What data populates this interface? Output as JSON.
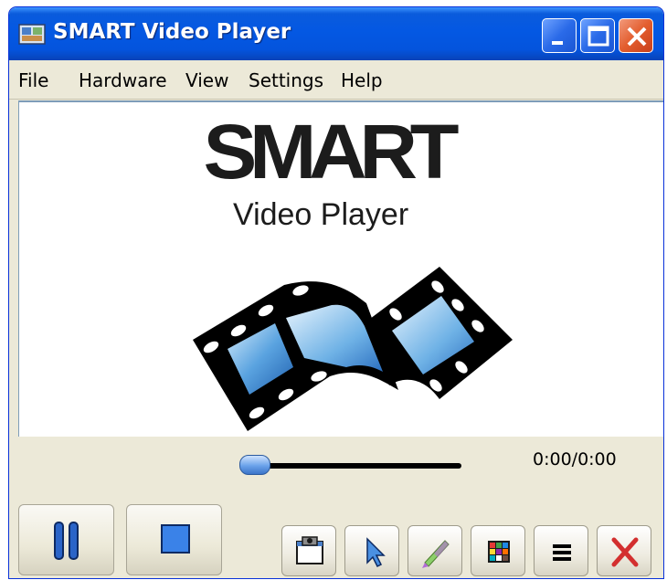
{
  "window": {
    "title": "SMART Video Player"
  },
  "menu": {
    "items": [
      "File",
      "Hardware",
      "View",
      "Settings",
      "Help"
    ]
  },
  "video": {
    "logo_text": "SMART",
    "logo_subtitle": "Video Player"
  },
  "playback": {
    "time_display": "0:00/0:00",
    "progress_fraction": 0
  },
  "colors": {
    "titlebar_blue": "#0458e3",
    "close_red": "#e35d2e",
    "film_blue": "#3b8ed8"
  },
  "icons": {
    "pause": "pause-icon",
    "stop": "stop-icon",
    "capture": "capture-icon",
    "select": "pointer-icon",
    "pen": "pen-icon",
    "color": "color-palette-icon",
    "menu": "hamburger-menu-icon",
    "close": "close-icon"
  }
}
